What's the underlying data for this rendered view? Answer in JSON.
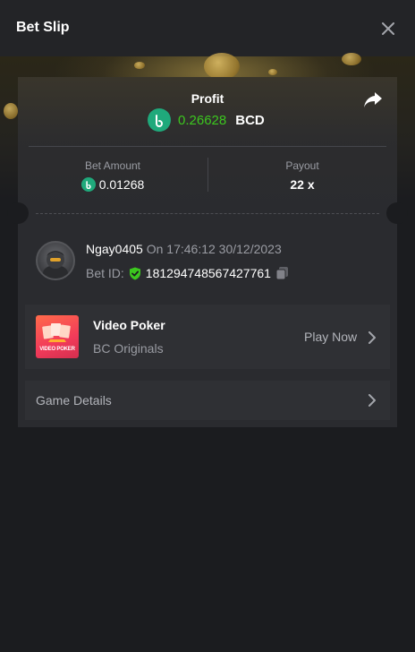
{
  "header": {
    "title": "Bet Slip",
    "close_icon": "close-icon"
  },
  "profit": {
    "label": "Profit",
    "value": "0.26628",
    "currency": "BCD",
    "value_color": "#3cc71f",
    "coin_color": "#1fa97b"
  },
  "stats": {
    "bet_amount_label": "Bet Amount",
    "bet_amount_value": "0.01268",
    "payout_label": "Payout",
    "payout_value": "22 x"
  },
  "user": {
    "name": "Ngay0405",
    "time": "On 17:46:12 30/12/2023",
    "bet_id_label": "Bet ID:",
    "bet_id_value": "181294748567427761"
  },
  "game": {
    "name": "Video Poker",
    "provider": "BC Originals",
    "play_label": "Play Now",
    "thumb_label": "VIDEO POKER"
  },
  "details": {
    "label": "Game Details"
  }
}
